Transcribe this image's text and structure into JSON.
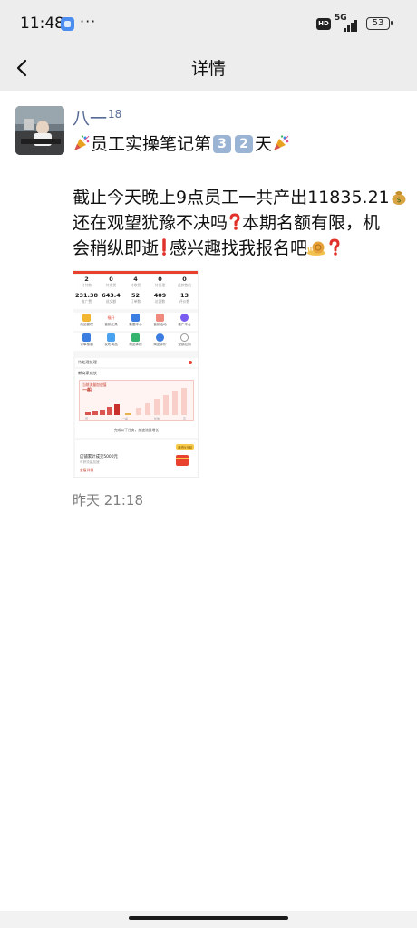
{
  "status_bar": {
    "time": "11:48",
    "more": "···",
    "hd": "HD",
    "network": "5G",
    "battery": "53"
  },
  "nav": {
    "title": "详情",
    "back_icon": "chevron-left-icon"
  },
  "post": {
    "username": "八一",
    "username_sup": "18",
    "line1": {
      "pre": "员工实操笔记第",
      "n1": "3",
      "n2": "2",
      "post": "天"
    },
    "line2": "截止今天晚上9点员工一共产出11835.21",
    "line3a": "还在观望犹豫不决吗",
    "line3b": "本期名额有限，机",
    "line4a": "会稍纵即逝",
    "line4b": "感兴趣找我报名吧",
    "time": "昨天 21:18",
    "emojis": [
      "party-popper-icon",
      "money-bag-icon",
      "red-question-icon",
      "red-exclamation-icon",
      "snail-icon"
    ]
  },
  "thumbnail": {
    "stats_top": [
      {
        "value": "2",
        "label": "待付款"
      },
      {
        "value": "0",
        "label": "待发货"
      },
      {
        "value": "4",
        "label": "待收货"
      },
      {
        "value": "0",
        "label": "待处理"
      },
      {
        "value": "0",
        "label": "退款售后"
      }
    ],
    "stats_bottom": [
      {
        "value": "231.38",
        "label": "推广费"
      },
      {
        "value": "643.4",
        "label": "成交额"
      },
      {
        "value": "52",
        "label": "订单数"
      },
      {
        "value": "409",
        "label": "访客数"
      },
      {
        "value": "13",
        "label": "评价数"
      }
    ],
    "icons_row1": [
      "商品管理",
      "营销工具",
      "数据中心",
      "营销活动",
      "推广平台"
    ],
    "icons_row2": [
      "订单核销",
      "发布商品",
      "商品体检",
      "商品评价",
      "全部应用"
    ],
    "upgrade_badge": "福升",
    "todo": "待处理处理",
    "growth_title": "新商家成长",
    "chart_title": "当前流量加速值",
    "chart_level": "一般",
    "chart_x": [
      "低",
      "一般",
      "优秀",
      "高"
    ],
    "chart_sub": "完成以下任务，加速流量增长",
    "shop_tag": "最低5元起",
    "shop_task": "店铺累计成交5000元",
    "shop_hint": "可获流量加速",
    "shop_link": "查看详情"
  }
}
